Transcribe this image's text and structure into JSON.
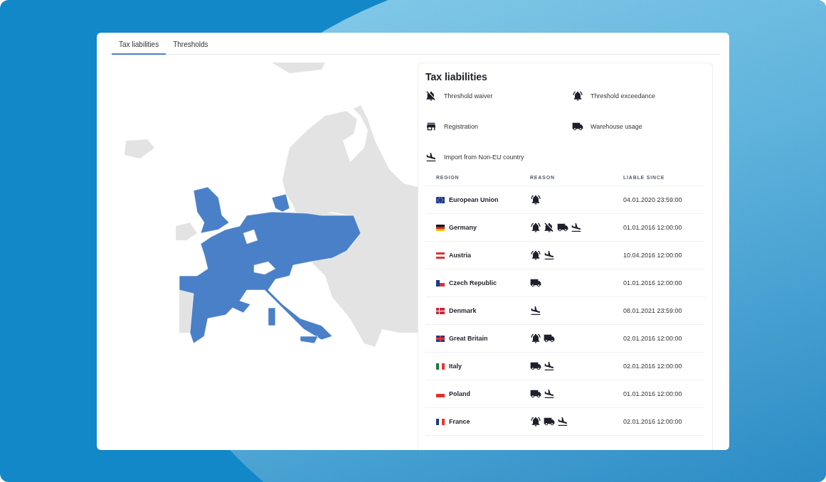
{
  "tabs": [
    {
      "label": "Tax liabilities",
      "selected": true
    },
    {
      "label": "Thresholds",
      "selected": false
    }
  ],
  "panel": {
    "title": "Tax liabilities",
    "legend": [
      {
        "kind": "bell-off",
        "label": "Threshold waiver"
      },
      {
        "kind": "bell",
        "label": "Threshold exceedance"
      },
      {
        "kind": "store",
        "label": "Registration"
      },
      {
        "kind": "truck",
        "label": "Warehouse usage"
      },
      {
        "kind": "landing",
        "label": "Import from Non-EU country"
      }
    ],
    "table": {
      "columns": [
        "REGION",
        "REASON",
        "LIABLE SINCE"
      ],
      "rows": [
        {
          "flag": {
            "kind": "eu"
          },
          "region": "European Union",
          "reasons": [
            {
              "kind": "bell"
            }
          ],
          "since": "04.01.2020 23:59:00"
        },
        {
          "flag": {
            "kind": "de"
          },
          "region": "Germany",
          "reasons": [
            {
              "kind": "bell"
            },
            {
              "kind": "bell-off"
            },
            {
              "kind": "truck"
            },
            {
              "kind": "landing"
            }
          ],
          "since": "01.01.2016 12:00:00"
        },
        {
          "flag": {
            "kind": "at"
          },
          "region": "Austria",
          "reasons": [
            {
              "kind": "bell"
            },
            {
              "kind": "landing"
            }
          ],
          "since": "10.04.2016 12:00:00"
        },
        {
          "flag": {
            "kind": "cz"
          },
          "region": "Czech Republic",
          "reasons": [
            {
              "kind": "truck"
            }
          ],
          "since": "01.01.2016 12:00:00"
        },
        {
          "flag": {
            "kind": "dk"
          },
          "region": "Denmark",
          "reasons": [
            {
              "kind": "landing"
            }
          ],
          "since": "08.01.2021 23:59:00"
        },
        {
          "flag": {
            "kind": "gb"
          },
          "region": "Great Britain",
          "reasons": [
            {
              "kind": "bell"
            },
            {
              "kind": "truck"
            }
          ],
          "since": "02.01.2016 12:00:00"
        },
        {
          "flag": {
            "kind": "it"
          },
          "region": "Italy",
          "reasons": [
            {
              "kind": "truck"
            },
            {
              "kind": "landing"
            }
          ],
          "since": "02.01.2016 12:00:00"
        },
        {
          "flag": {
            "kind": "pl"
          },
          "region": "Poland",
          "reasons": [
            {
              "kind": "truck"
            },
            {
              "kind": "landing"
            }
          ],
          "since": "01.01.2016 12:00:00"
        },
        {
          "flag": {
            "kind": "fr"
          },
          "region": "France",
          "reasons": [
            {
              "kind": "bell"
            },
            {
              "kind": "truck"
            },
            {
              "kind": "landing"
            }
          ],
          "since": "02.01.2016 12:00:00"
        }
      ]
    }
  }
}
